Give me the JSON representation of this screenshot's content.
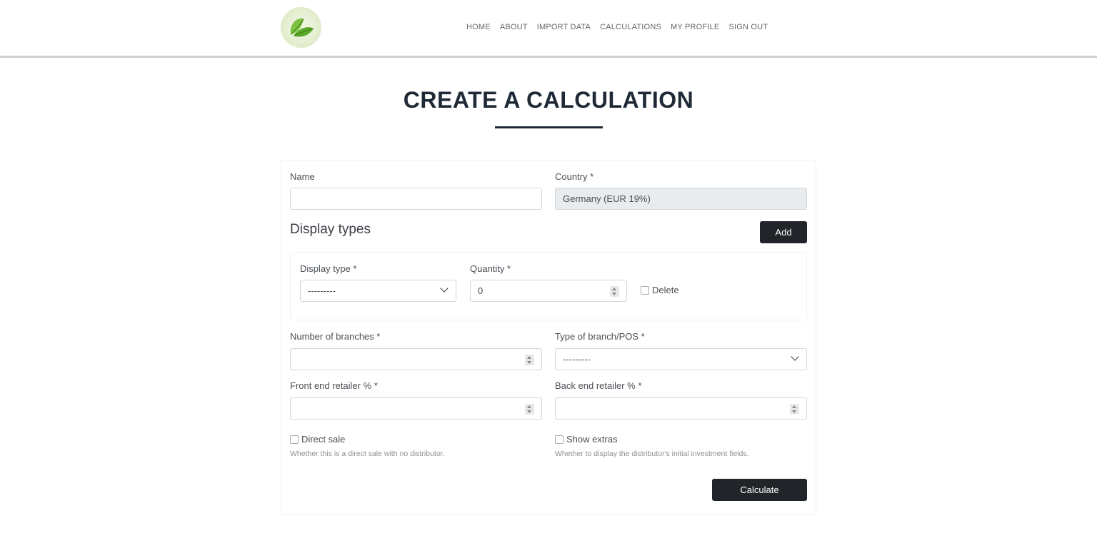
{
  "nav": {
    "logo_icon": "leaf-logo-icon",
    "items": [
      "HOME",
      "ABOUT",
      "IMPORT DATA",
      "CALCULATIONS",
      "MY PROFILE",
      "SIGN OUT"
    ]
  },
  "page": {
    "title": "CREATE A CALCULATION"
  },
  "form": {
    "name": {
      "label": "Name",
      "value": ""
    },
    "country": {
      "label": "Country *",
      "value": "Germany (EUR 19%)"
    },
    "display_types": {
      "title": "Display types",
      "add_label": "Add",
      "row": {
        "display_type_label": "Display type *",
        "display_type_value": "---------",
        "quantity_label": "Quantity *",
        "quantity_value": "0",
        "delete_label": "Delete"
      }
    },
    "branches": {
      "label": "Number of branches *",
      "value": ""
    },
    "branch_type": {
      "label": "Type of branch/POS *",
      "value": "---------"
    },
    "front_end": {
      "label": "Front end retailer % *",
      "value": ""
    },
    "back_end": {
      "label": "Back end retailer % *",
      "value": ""
    },
    "direct_sale": {
      "label": "Direct sale",
      "help": "Whether this is a direct sale with no distributor."
    },
    "show_extras": {
      "label": "Show extras",
      "help": "Whether to display the distributor's initial investment fields."
    },
    "calculate_label": "Calculate"
  },
  "colors": {
    "primary_dark": "#212529",
    "title": "#1f2a36",
    "disabled_bg": "#e9ecef"
  }
}
